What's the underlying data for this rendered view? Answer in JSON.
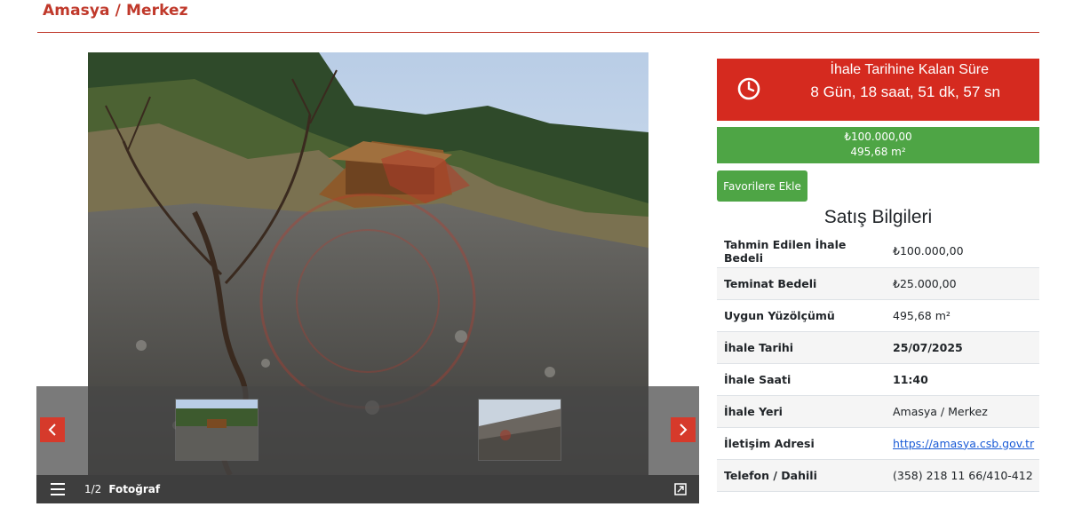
{
  "header": {
    "title": "Amasya / Merkez"
  },
  "gallery": {
    "counter": "1/2",
    "caption": "Fotoğraf",
    "thumbnails": [
      "photo-1",
      "photo-2"
    ],
    "icons": {
      "prev": "chevron-left-icon",
      "next": "chevron-right-icon",
      "menu": "list-icon",
      "fullscreen": "expand-icon"
    }
  },
  "countdown": {
    "label": "İhale Tarihine Kalan Süre",
    "value": "8 Gün, 18 saat, 51 dk, 57 sn",
    "icon": "clock-icon"
  },
  "price": {
    "amount": "₺100.000,00",
    "area": "495,68 m²"
  },
  "favorite": {
    "label": "Favorilere Ekle"
  },
  "sales": {
    "title": "Satış Bilgileri",
    "rows": [
      {
        "label": "Tahmin Edilen İhale Bedeli",
        "value": "₺100.000,00"
      },
      {
        "label": "Teminat Bedeli",
        "value": "₺25.000,00"
      },
      {
        "label": "Uygun Yüzölçümü",
        "value": "495,68 m²"
      },
      {
        "label": "İhale Tarihi",
        "value": "25/07/2025"
      },
      {
        "label": "İhale Saati",
        "value": "11:40"
      },
      {
        "label": "İhale Yeri",
        "value": "Amasya / Merkez"
      },
      {
        "label": "İletişim Adresi",
        "value": "https://amasya.csb.gov.tr"
      },
      {
        "label": "Telefon / Dahili",
        "value": "(358) 218 11 66/410-412"
      }
    ]
  },
  "colors": {
    "accent": "#c0392b",
    "countdown_bg": "#d52a1f",
    "success": "#4ea545",
    "link": "#1a5bd6"
  }
}
